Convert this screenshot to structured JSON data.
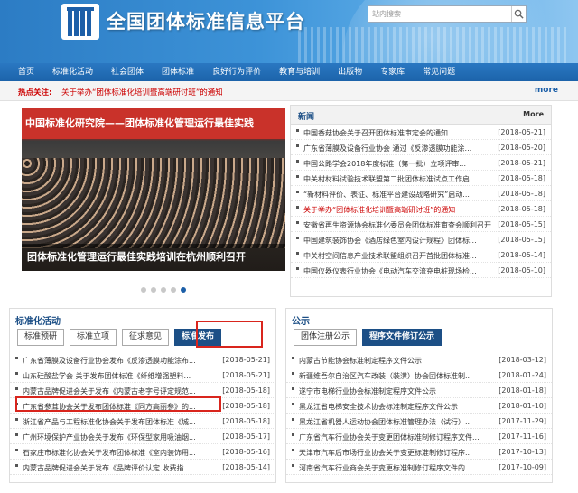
{
  "header": {
    "title": "全国团体标准信息平台",
    "search_placeholder": "站内搜索"
  },
  "nav": [
    "首页",
    "标准化活动",
    "社会团体",
    "团体标准",
    "良好行为评价",
    "教育与培训",
    "出版物",
    "专家库",
    "常见问题"
  ],
  "hot": {
    "label": "热点关注:",
    "text": "关于举办“团体标准化培训暨高端研讨班”的通知",
    "more": "more"
  },
  "carousel": {
    "headline": "中国标准化研究院——团体标准化管理运行最佳实践",
    "caption": "团体标准化管理运行最佳实践培训在杭州顺利召开",
    "dots": 5,
    "active": 4
  },
  "news": {
    "title": "新闻",
    "more": "More",
    "items": [
      {
        "t": "中国香菇协会关于召开团体标准审定会的通知",
        "d": "[2018-05-21]"
      },
      {
        "t": "广东省薄膜及设备行业协会 通过《反渗透膜功能涂...",
        "d": "[2018-05-20]"
      },
      {
        "t": "中国公路学会2018年度标准（第一批）立项评审...",
        "d": "[2018-05-21]"
      },
      {
        "t": "中关村材料试验技术联盟第二批团体标准试点工作启...",
        "d": "[2018-05-18]"
      },
      {
        "t": "“新材料评价、表征、标准平台建设战略研究”启动...",
        "d": "[2018-05-18]"
      },
      {
        "t": "关于举办“团体标准化培训暨高端研讨班”的通知",
        "d": "[2018-05-18]",
        "hot": true
      },
      {
        "t": "安徽省再生资源协会标准化委员会团体标准审查会顺利召开",
        "d": "[2018-05-15]"
      },
      {
        "t": "中国建筑装饰协会《酒店绿色室内设计规程》团体标...",
        "d": "[2018-05-15]"
      },
      {
        "t": "中关村空间信息产业技术联盟组织召开首批团体标准...",
        "d": "[2018-05-14]"
      },
      {
        "t": "中国仪器仪表行业协会《电动汽车交流充电桩现场检...",
        "d": "[2018-05-10]"
      }
    ]
  },
  "standardization": {
    "title": "标准化活动",
    "tabs": [
      "标准预研",
      "标准立项",
      "征求意见",
      "标准发布"
    ],
    "active": 3,
    "items": [
      {
        "t": "广东省薄膜及设备行业协会发布《反渗透膜功能涂布...",
        "d": "[2018-05-21]"
      },
      {
        "t": "山东硅酸盐学会 关于发布团体标准《纤维增强塑料...",
        "d": "[2018-05-21]"
      },
      {
        "t": "内蒙古品牌促进会关于发布《内蒙古老字号评定规范...",
        "d": "[2018-05-18]"
      },
      {
        "t": "广东省参茸协会关于发布团体标准《同方高丽参》的...",
        "d": "[2018-05-18]"
      },
      {
        "t": "浙江省产品与工程标准化协会关于发布团体标准《城...",
        "d": "[2018-05-18]"
      },
      {
        "t": "广州环境保护产业协会关于发布《环保型家用吸油烟...",
        "d": "[2018-05-17]"
      },
      {
        "t": "石家庄市标准化协会关于发布团体标准《室内装饰用...",
        "d": "[2018-05-16]"
      },
      {
        "t": "内蒙古品牌促进会关于发布《品牌评价认定 收费指...",
        "d": "[2018-05-14]"
      }
    ]
  },
  "notice": {
    "title": "公示",
    "tabs": [
      "团体注册公示",
      "程序文件修订公示"
    ],
    "active": 1,
    "items": [
      {
        "t": "内蒙古节能协会标准制定程序文件公示",
        "d": "[2018-03-12]"
      },
      {
        "t": "新疆维吾尔自治区汽车改装（装潢）协会团体标准制...",
        "d": "[2018-01-24]"
      },
      {
        "t": "遂宁市电梯行业协会标准制定程序文件公示",
        "d": "[2018-01-18]"
      },
      {
        "t": "黑龙江省电梯安全技术协会标准制定程序文件公示",
        "d": "[2018-01-10]"
      },
      {
        "t": "黑龙江省机器人运动协会团体标准管理办法（试行）...",
        "d": "[2017-11-29]"
      },
      {
        "t": "广东省汽车行业协会关于变更团体标准制修订程序文件...",
        "d": "[2017-11-16]"
      },
      {
        "t": "天津市汽车后市场行业协会关于变更标准制修订程序...",
        "d": "[2017-10-13]"
      },
      {
        "t": "河南省汽车行业商会关于变更标准制修订程序文件的...",
        "d": "[2017-10-09]"
      }
    ]
  },
  "colors": {
    "accent": "#1c4f86",
    "highlight": "#d9251d",
    "hot": "#cc0000"
  }
}
